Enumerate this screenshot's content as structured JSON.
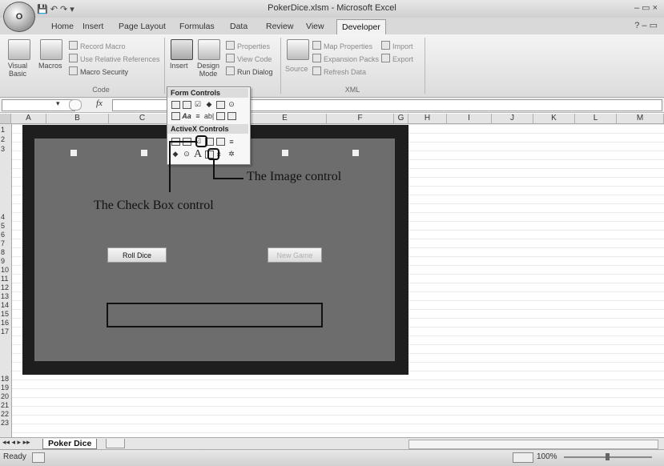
{
  "window": {
    "title": "PokerDice.xlsm - Microsoft Excel",
    "office_button": "O",
    "qat_icons": "💾 ↶ ↷ ▾",
    "controls": "–  ▭  ×"
  },
  "tabs": [
    "Home",
    "Insert",
    "Page Layout",
    "Formulas",
    "Data",
    "Review",
    "View",
    "Developer"
  ],
  "active_tab": "Developer",
  "ribbon": {
    "code": {
      "visual_basic": "Visual Basic",
      "macros": "Macros",
      "record_macro": "Record Macro",
      "use_relative": "Use Relative References",
      "macro_security": "Macro Security",
      "group": "Code"
    },
    "controls": {
      "insert": "Insert",
      "design_mode": "Design Mode",
      "properties": "Properties",
      "view_code": "View Code",
      "run_dialog": "Run Dialog"
    },
    "xml": {
      "source": "Source",
      "map_properties": "Map Properties",
      "expansion_packs": "Expansion Packs",
      "refresh_data": "Refresh Data",
      "import": "Import",
      "export": "Export",
      "group": "XML"
    }
  },
  "formula_bar": {
    "fx": "fx",
    "value": ""
  },
  "columns": [
    "A",
    "B",
    "C",
    "D",
    "E",
    "F",
    "G",
    "H",
    "I",
    "J",
    "K",
    "L",
    "M"
  ],
  "rows": [
    "1",
    "2",
    "3",
    "4",
    "5",
    "6",
    "7",
    "8",
    "9",
    "10",
    "11",
    "12",
    "13",
    "14",
    "15",
    "16",
    "17",
    "18",
    "19",
    "20",
    "21",
    "22",
    "23"
  ],
  "dropdown": {
    "form_controls": "Form Controls",
    "activex_controls": "ActiveX Controls"
  },
  "form": {
    "roll_dice": "Roll Dice",
    "new_game": "New Game"
  },
  "annotations": {
    "checkbox": "The Check Box control",
    "image": "The Image control"
  },
  "sheet_tab": "Poker Dice",
  "status": {
    "ready": "Ready",
    "zoom": "100%"
  },
  "colors": {
    "form_frame": "#1e1e1e",
    "form_surface": "#6d6d6d"
  }
}
